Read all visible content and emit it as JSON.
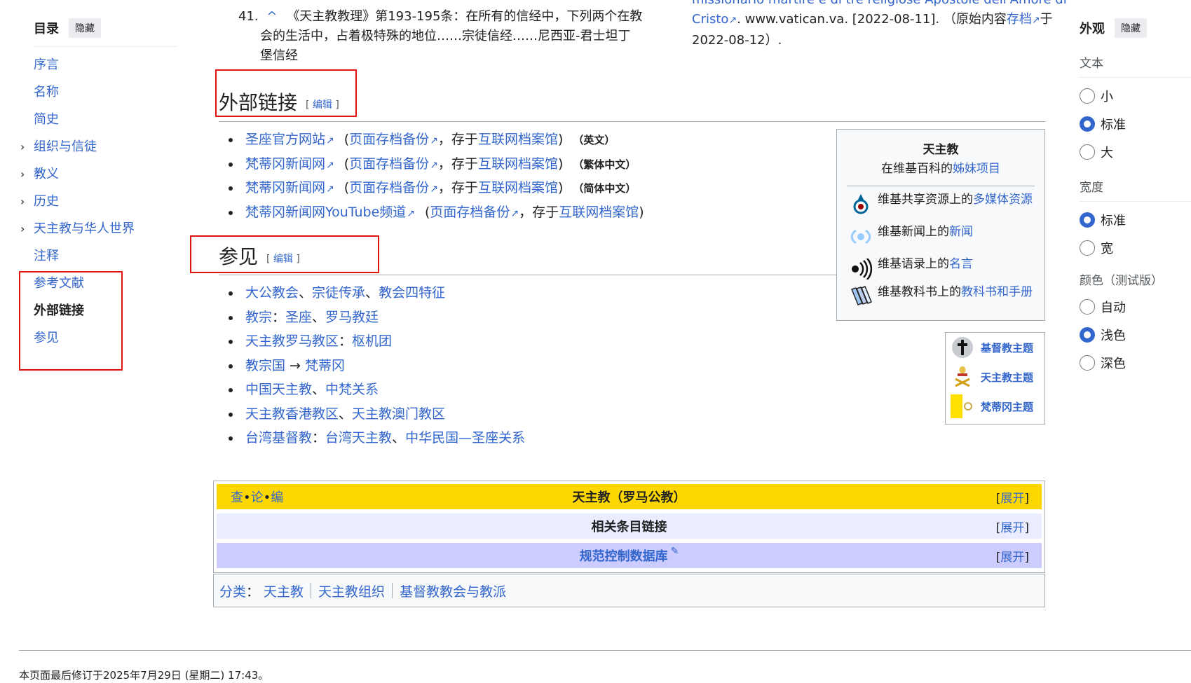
{
  "toc": {
    "title": "目录",
    "hide_label": "隐藏",
    "items": [
      {
        "label": "序言",
        "expandable": false
      },
      {
        "label": "名称",
        "expandable": false
      },
      {
        "label": "简史",
        "expandable": false
      },
      {
        "label": "组织与信徒",
        "expandable": true
      },
      {
        "label": "教义",
        "expandable": true
      },
      {
        "label": "历史",
        "expandable": true
      },
      {
        "label": "天主教与华人世界",
        "expandable": true
      },
      {
        "label": "注释",
        "expandable": false
      },
      {
        "label": "参考文献",
        "expandable": false
      },
      {
        "label": "外部链接",
        "expandable": false,
        "active": true
      },
      {
        "label": "参见",
        "expandable": false
      }
    ]
  },
  "refs": {
    "number": "41.",
    "caret": "^",
    "line1": "《天主教教理》第193-195条：在所有的信经中，下列两个在教",
    "line2": "会的生活中，占着极特殊的地位……宗徒信经……尼西亚-君士坦丁",
    "line3": "堡信经",
    "right_top": "missionario martire e di tre religiose Apostole dell'Amore di",
    "right_line1_link": "Cristo",
    "right_line1_text": ". www.vatican.va. [2022-08-11]. （原始内容",
    "right_line1_archive": "存档",
    "right_line1_end": "于",
    "right_line2": "2022-08-12）."
  },
  "external": {
    "heading": "外部链接",
    "edit_open": "[ ",
    "edit": "编辑",
    "edit_close": " ]",
    "items": [
      {
        "link": "圣座官方网站",
        "archive": "页面存档备份",
        "mid": "，存于",
        "archive_site": "互联网档案馆",
        "lang": "（英文）"
      },
      {
        "link": "梵蒂冈新闻网",
        "archive": "页面存档备份",
        "mid": "，存于",
        "archive_site": "互联网档案馆",
        "lang": "（繁体中文）"
      },
      {
        "link": "梵蒂冈新闻网",
        "archive": "页面存档备份",
        "mid": "，存于",
        "archive_site": "互联网档案馆",
        "lang": "（简体中文）"
      },
      {
        "link": "梵蒂冈新闻网YouTube频道",
        "archive": "页面存档备份",
        "mid": "，存于",
        "archive_site": "互联网档案馆",
        "lang": ""
      }
    ]
  },
  "see_also": {
    "heading": "参见",
    "edit": "编辑",
    "items": [
      {
        "parts": [
          {
            "t": "大公教会",
            "l": true
          },
          {
            "t": "、",
            "l": false
          },
          {
            "t": "宗徒传承",
            "l": true
          },
          {
            "t": "、",
            "l": false
          },
          {
            "t": "教会四特征",
            "l": true
          }
        ]
      },
      {
        "parts": [
          {
            "t": "教宗",
            "l": true
          },
          {
            "t": "：",
            "l": false
          },
          {
            "t": "圣座",
            "l": true
          },
          {
            "t": "、",
            "l": false
          },
          {
            "t": "罗马教廷",
            "l": true
          }
        ]
      },
      {
        "parts": [
          {
            "t": "天主教罗马教区",
            "l": true
          },
          {
            "t": "：",
            "l": false
          },
          {
            "t": "枢机团",
            "l": true
          }
        ]
      },
      {
        "parts": [
          {
            "t": "教宗国",
            "l": true
          },
          {
            "t": " → ",
            "l": false
          },
          {
            "t": "梵蒂冈",
            "l": true
          }
        ]
      },
      {
        "parts": [
          {
            "t": "中国天主教",
            "l": true
          },
          {
            "t": "、",
            "l": false
          },
          {
            "t": "中梵关系",
            "l": true
          }
        ]
      },
      {
        "parts": [
          {
            "t": "天主教香港教区",
            "l": true
          },
          {
            "t": "、",
            "l": false
          },
          {
            "t": "天主教澳门教区",
            "l": true
          }
        ]
      },
      {
        "parts": [
          {
            "t": "台湾基督教",
            "l": true
          },
          {
            "t": "：",
            "l": false
          },
          {
            "t": "台湾天主教",
            "l": true
          },
          {
            "t": "、",
            "l": false
          },
          {
            "t": "中华民国—圣座关系",
            "l": true
          }
        ]
      }
    ]
  },
  "sister": {
    "title": "天主教",
    "subtitle_pre": "在维基百科的",
    "subtitle_link": "姊妹项目",
    "rows": [
      {
        "icon": "commons-icon",
        "pre": "维基共享资源上的",
        "link": "多媒体资源"
      },
      {
        "icon": "wikinews-icon",
        "pre": "维基新闻上的",
        "link": "新闻"
      },
      {
        "icon": "wikiquote-icon",
        "pre": "维基语录上的",
        "link": "名言"
      },
      {
        "icon": "wikibooks-icon",
        "pre": "维基教科书上的",
        "link": "教科书和手册"
      }
    ]
  },
  "portals": [
    {
      "icon": "cross-icon",
      "label": "基督教主题"
    },
    {
      "icon": "papal-arms-icon",
      "label": "天主教主题"
    },
    {
      "icon": "vatican-flag-icon",
      "label": "梵蒂冈主题"
    }
  ],
  "navbox": {
    "vte_v": "查",
    "vte_t": "论",
    "vte_e": "编",
    "dot": "•",
    "title": "天主教（罗马公教）",
    "expand": "展开",
    "row2": "相关条目链接",
    "row3": "规范控制数据库",
    "bracket_open": "[",
    "bracket_close": "]",
    "colors": {
      "title_bg": "#ffd700",
      "row2_bg": "#eaecff",
      "row3_bg": "#ccccff"
    }
  },
  "categories": {
    "label": "分类",
    "colon": "：",
    "items": [
      "天主教",
      "天主教组织",
      "基督教教会与教派"
    ]
  },
  "appearance": {
    "title": "外观",
    "hide_label": "隐藏",
    "text_label": "文本",
    "text_options": [
      {
        "label": "小",
        "on": false
      },
      {
        "label": "标准",
        "on": true
      },
      {
        "label": "大",
        "on": false
      }
    ],
    "width_label": "宽度",
    "width_options": [
      {
        "label": "标准",
        "on": true
      },
      {
        "label": "宽",
        "on": false
      }
    ],
    "color_label": "颜色（测试版）",
    "color_options": [
      {
        "label": "自动",
        "on": false
      },
      {
        "label": "浅色",
        "on": true
      },
      {
        "label": "深色",
        "on": false
      }
    ]
  },
  "footer": {
    "last_modified": "本页面最后修订于2025年7月29日 (星期二) 17:43。"
  }
}
